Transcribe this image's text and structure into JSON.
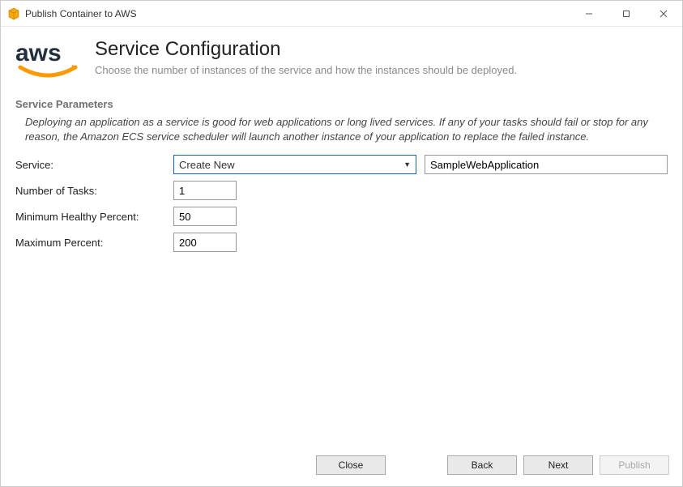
{
  "window": {
    "title": "Publish Container to AWS"
  },
  "header": {
    "title": "Service Configuration",
    "subtitle": "Choose the number of instances of the service and how the instances should be deployed."
  },
  "section": {
    "title": "Service Parameters",
    "description": "Deploying an application as a service is good for web applications or long lived services. If any of your tasks should fail or stop for any reason, the Amazon ECS service scheduler will launch another instance of your application to replace the failed instance."
  },
  "form": {
    "service_label": "Service:",
    "service_selected": "Create New",
    "service_name_value": "SampleWebApplication",
    "tasks_label": "Number of Tasks:",
    "tasks_value": "1",
    "min_label": "Minimum Healthy Percent:",
    "min_value": "50",
    "max_label": "Maximum Percent:",
    "max_value": "200"
  },
  "footer": {
    "close": "Close",
    "back": "Back",
    "next": "Next",
    "publish": "Publish"
  }
}
